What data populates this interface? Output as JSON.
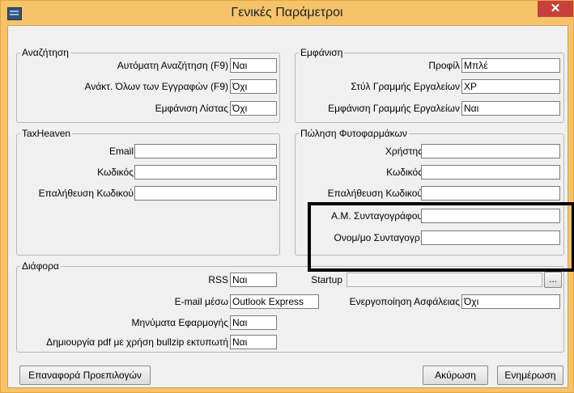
{
  "window": {
    "title": "Γενικές Παράμετροι",
    "close_glyph": "✕",
    "icon": "app-icon"
  },
  "search": {
    "legend": "Αναζήτηση",
    "fields": [
      {
        "label": "Αυτόματη Αναζήτηση (F9)",
        "value": "Ναι"
      },
      {
        "label": "Ανάκτ. Όλων των Εγγραφών (F9)",
        "value": "Όχι"
      },
      {
        "label": "Εμφάνιση Λίστας",
        "value": "Όχι"
      }
    ]
  },
  "appearance": {
    "legend": "Εμφάνιση",
    "fields": [
      {
        "label": "Προφίλ",
        "value": "Μπλέ"
      },
      {
        "label": "Στύλ Γραμμής Εργαλείων",
        "value": "XP"
      },
      {
        "label": "Εμφάνιση Γραμμής Εργαλείων",
        "value": "Ναι"
      }
    ]
  },
  "taxheaven": {
    "legend": "TaxHeaven",
    "fields": [
      {
        "label": "Email",
        "value": ""
      },
      {
        "label": "Κωδικός",
        "value": ""
      },
      {
        "label": "Επαλήθευση Κωδικού",
        "value": ""
      }
    ]
  },
  "pharma": {
    "legend": "Πώληση Φυτοφαρμάκων",
    "fields": [
      {
        "label": "Χρήστης",
        "value": ""
      },
      {
        "label": "Κωδικός",
        "value": ""
      },
      {
        "label": "Επαλήθευση Κωδικού",
        "value": ""
      },
      {
        "label": "Α.Μ. Συνταγογράφου",
        "value": ""
      },
      {
        "label": "Ονομ/μο Συνταγογρ.",
        "value": ""
      }
    ]
  },
  "misc": {
    "legend": "Διάφορα",
    "rss": {
      "label": "RSS",
      "value": "Ναι"
    },
    "email_via": {
      "label": "E-mail μέσω",
      "value": "Outlook Express"
    },
    "app_messages": {
      "label": "Μηνύματα Εφαρμογής",
      "value": "Ναι"
    },
    "pdf_bullzip": {
      "label": "Δημιουργία pdf με χρήση bullzip εκτυπωτή",
      "value": "Ναι"
    },
    "startup": {
      "label": "Startup",
      "value": "",
      "browse_label": "..."
    },
    "security": {
      "label": "Ενεργοποίηση Ασφάλειας",
      "value": "Όχι"
    }
  },
  "buttons": {
    "reset": "Επαναφορά Προεπιλογών",
    "cancel": "Ακύρωση",
    "update": "Ενημέρωση"
  }
}
